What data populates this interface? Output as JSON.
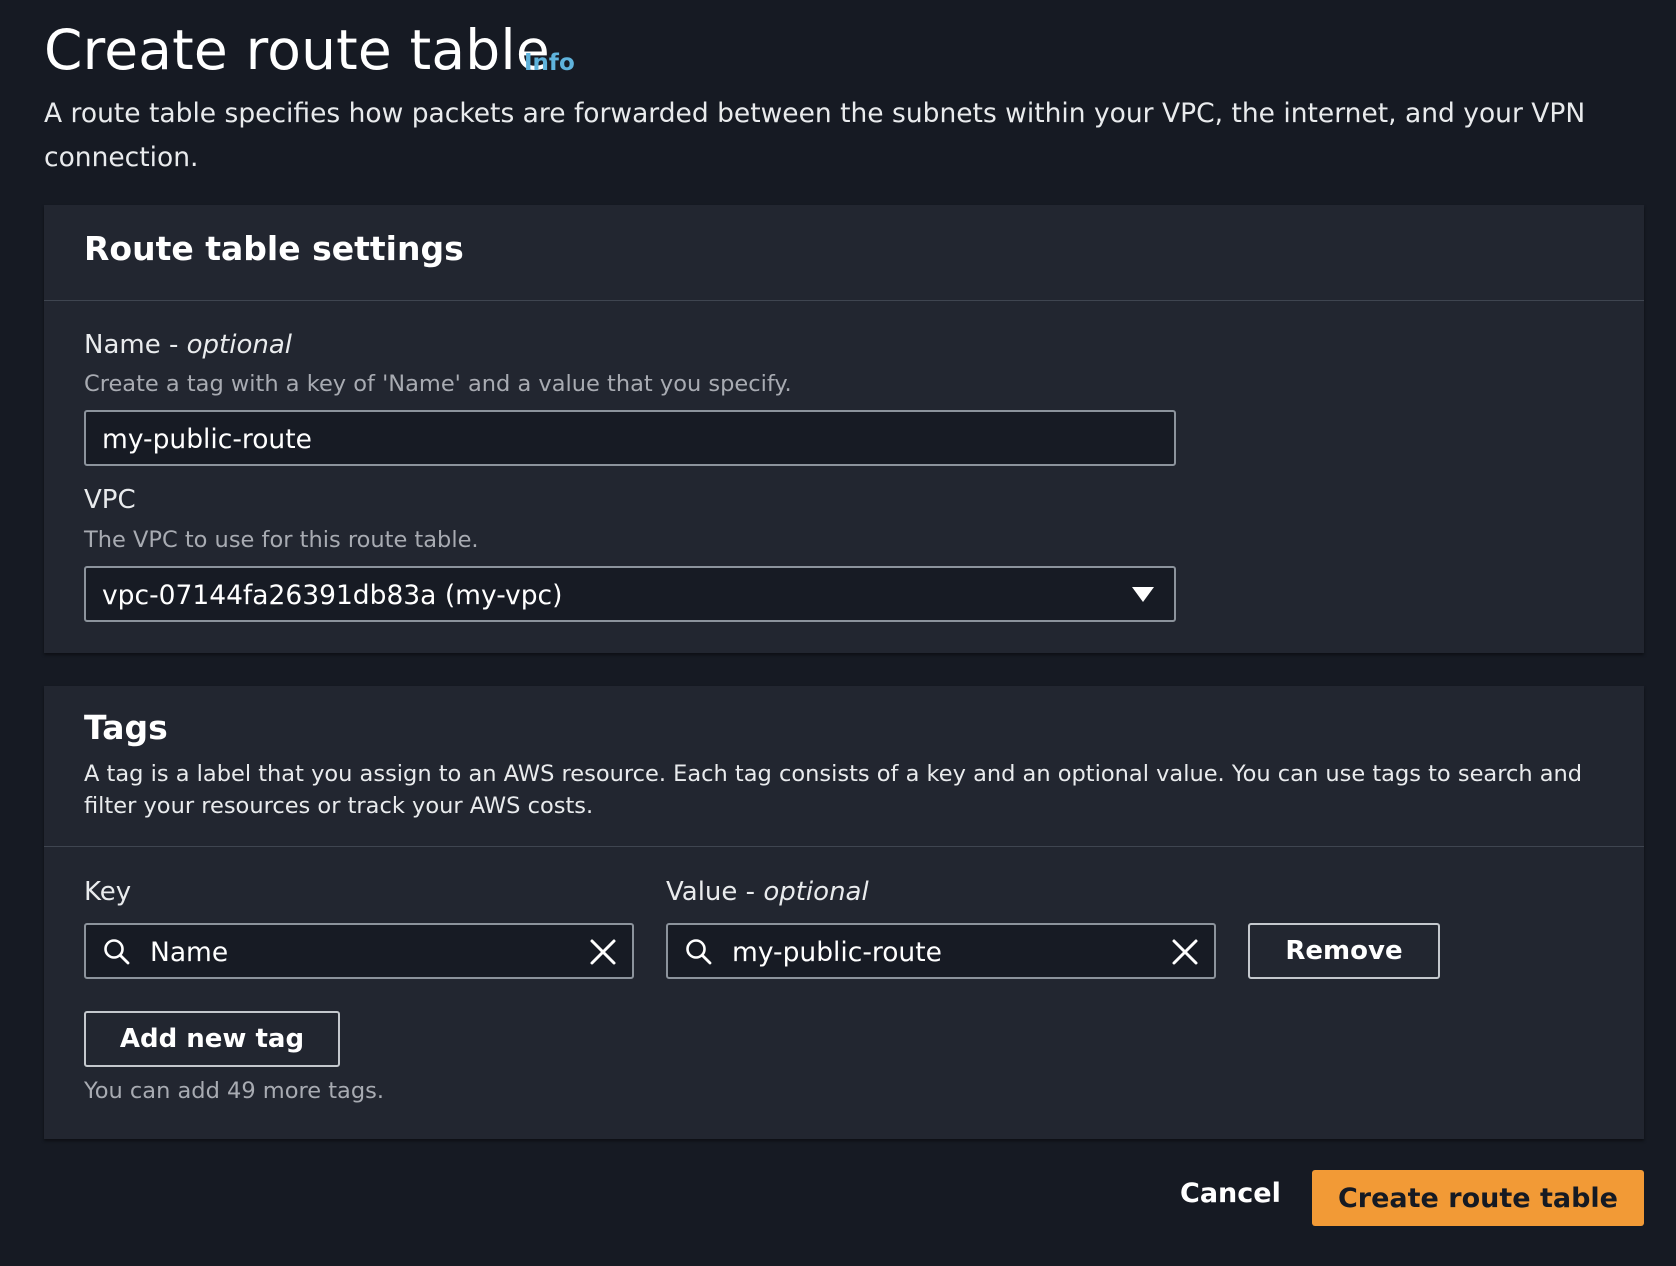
{
  "header": {
    "title": "Create route table",
    "info_link": "Info",
    "description": "A route table specifies how packets are forwarded between the subnets within your VPC, the internet, and your VPN connection."
  },
  "settings": {
    "title": "Route table settings",
    "name_field": {
      "label": "Name",
      "label_suffix": " - ",
      "optional": "optional",
      "hint": "Create a tag with a key of 'Name' and a value that you specify.",
      "value": "my-public-route"
    },
    "vpc_field": {
      "label": "VPC",
      "hint": "The VPC to use for this route table.",
      "selected": "vpc-07144fa26391db83a (my-vpc)"
    }
  },
  "tags": {
    "title": "Tags",
    "description": "A tag is a label that you assign to an AWS resource. Each tag consists of a key and an optional value. You can use tags to search and filter your resources or track your AWS costs.",
    "key_label": "Key",
    "value_label": "Value",
    "value_label_suffix": " - ",
    "value_optional": "optional",
    "rows": [
      {
        "key": "Name",
        "value": "my-public-route"
      }
    ],
    "remove_label": "Remove",
    "add_label": "Add new tag",
    "remaining_text": "You can add 49 more tags."
  },
  "footer": {
    "cancel_label": "Cancel",
    "submit_label": "Create route table"
  },
  "colors": {
    "background": "#161a23",
    "panel": "#222630",
    "accent_primary": "#f29a36",
    "link": "#5fb3dc"
  },
  "icons": {
    "search": "search-icon",
    "clear": "close-icon",
    "dropdown": "caret-down-icon"
  }
}
